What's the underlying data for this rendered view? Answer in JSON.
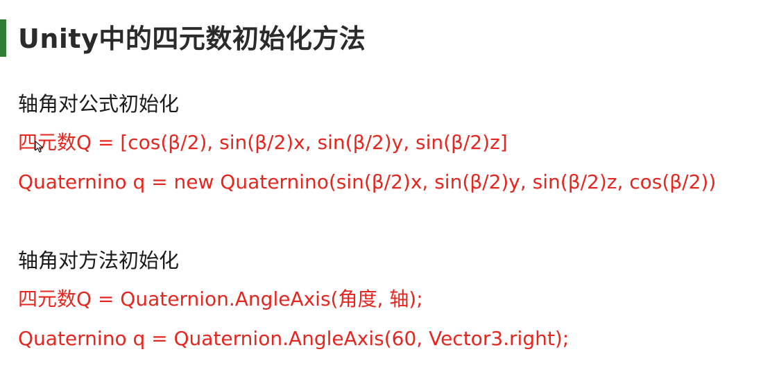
{
  "title": "Unity中的四元数初始化方法",
  "section1": {
    "heading": "轴角对公式初始化",
    "line1": "四元数Q =  [cos(β/2),  sin(β/2)x, sin(β/2)y, sin(β/2)z]",
    "line2": "Quaternino q = new Quaternino(sin(β/2)x, sin(β/2)y, sin(β/2)z, cos(β/2))"
  },
  "section2": {
    "heading": "轴角对方法初始化",
    "line1": "四元数Q =  Quaternion.AngleAxis(角度, 轴);",
    "line2": "Quaternino q = Quaternion.AngleAxis(60, Vector3.right);"
  },
  "colors": {
    "accent_bar": "#2e7d32",
    "title_text": "#2b2b2b",
    "heading_text": "#1a1a1a",
    "code_text": "#e5261f"
  },
  "icons": [
    "mouse-cursor-icon"
  ]
}
